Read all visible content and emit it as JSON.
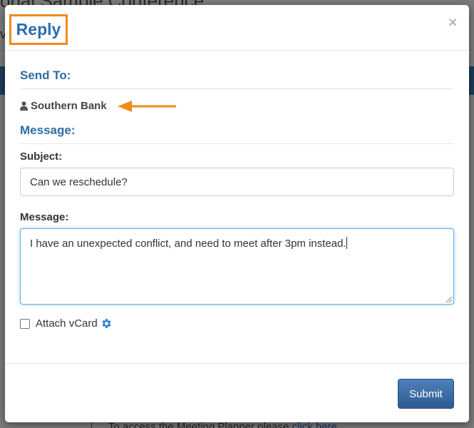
{
  "background": {
    "title_fragment": "onal Sample Conference",
    "sub_fragment": "v",
    "bottom_text": "To access the Meeting Planner please ",
    "bottom_link": "click here"
  },
  "modal": {
    "title": "Reply",
    "close_label": "×",
    "send_to_heading": "Send To:",
    "recipient": "Southern Bank",
    "message_heading": "Message:",
    "subject_label": "Subject:",
    "subject_value": "Can we reschedule?",
    "message_label": "Message:",
    "message_value": "I have an unexpected conflict, and need to meet after 3pm instead.",
    "attach_label": "Attach vCard",
    "attach_checked": false,
    "submit_label": "Submit"
  },
  "colors": {
    "annotation": "#f08a1c",
    "heading_blue": "#2e6da4",
    "submit_blue": "#3b6aa0"
  }
}
